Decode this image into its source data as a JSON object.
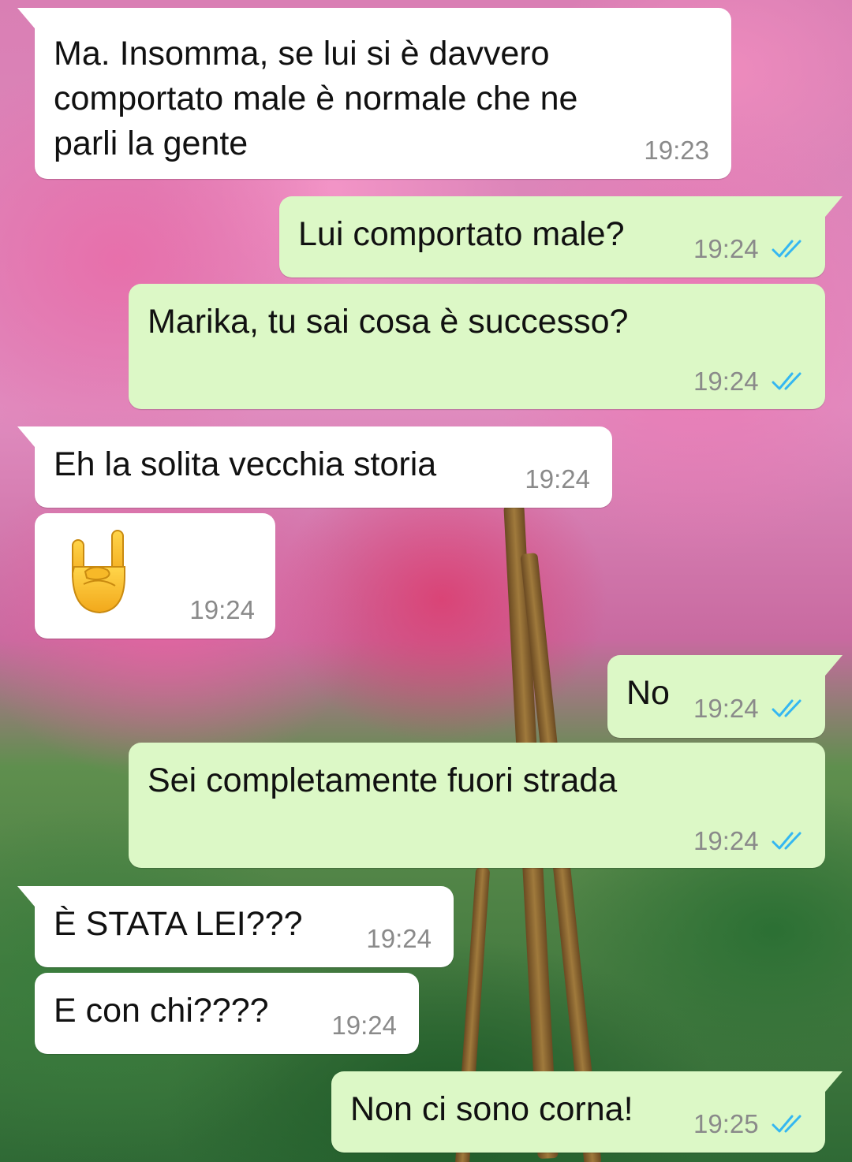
{
  "chat": {
    "messages": [
      {
        "direction": "incoming",
        "lines": [
          "Ma. Insomma, se lui si è davvero",
          "comportato male è normale che ne",
          "parli la gente"
        ],
        "time": "19:23"
      },
      {
        "direction": "outgoing",
        "text": "Lui comportato male?",
        "time": "19:24",
        "status": "read"
      },
      {
        "direction": "outgoing",
        "text": "Marika, tu sai cosa è successo?",
        "time": "19:24",
        "status": "read"
      },
      {
        "direction": "incoming",
        "text": "Eh la solita vecchia storia",
        "time": "19:24"
      },
      {
        "direction": "incoming",
        "emoji": "sign-of-the-horns",
        "time": "19:24"
      },
      {
        "direction": "outgoing",
        "text": "No",
        "time": "19:24",
        "status": "read"
      },
      {
        "direction": "outgoing",
        "text": "Sei completamente fuori strada",
        "time": "19:24",
        "status": "read"
      },
      {
        "direction": "incoming",
        "text": "È STATA LEI???",
        "time": "19:24"
      },
      {
        "direction": "incoming",
        "text": "E con chi????",
        "time": "19:24"
      },
      {
        "direction": "outgoing",
        "text": "Non ci sono corna!",
        "time": "19:25",
        "status": "read"
      }
    ]
  },
  "colors": {
    "incoming_bubble": "#ffffff",
    "outgoing_bubble": "#dcf8c6",
    "read_ticks": "#34b7f1",
    "timestamp": "#8a8a8a"
  }
}
